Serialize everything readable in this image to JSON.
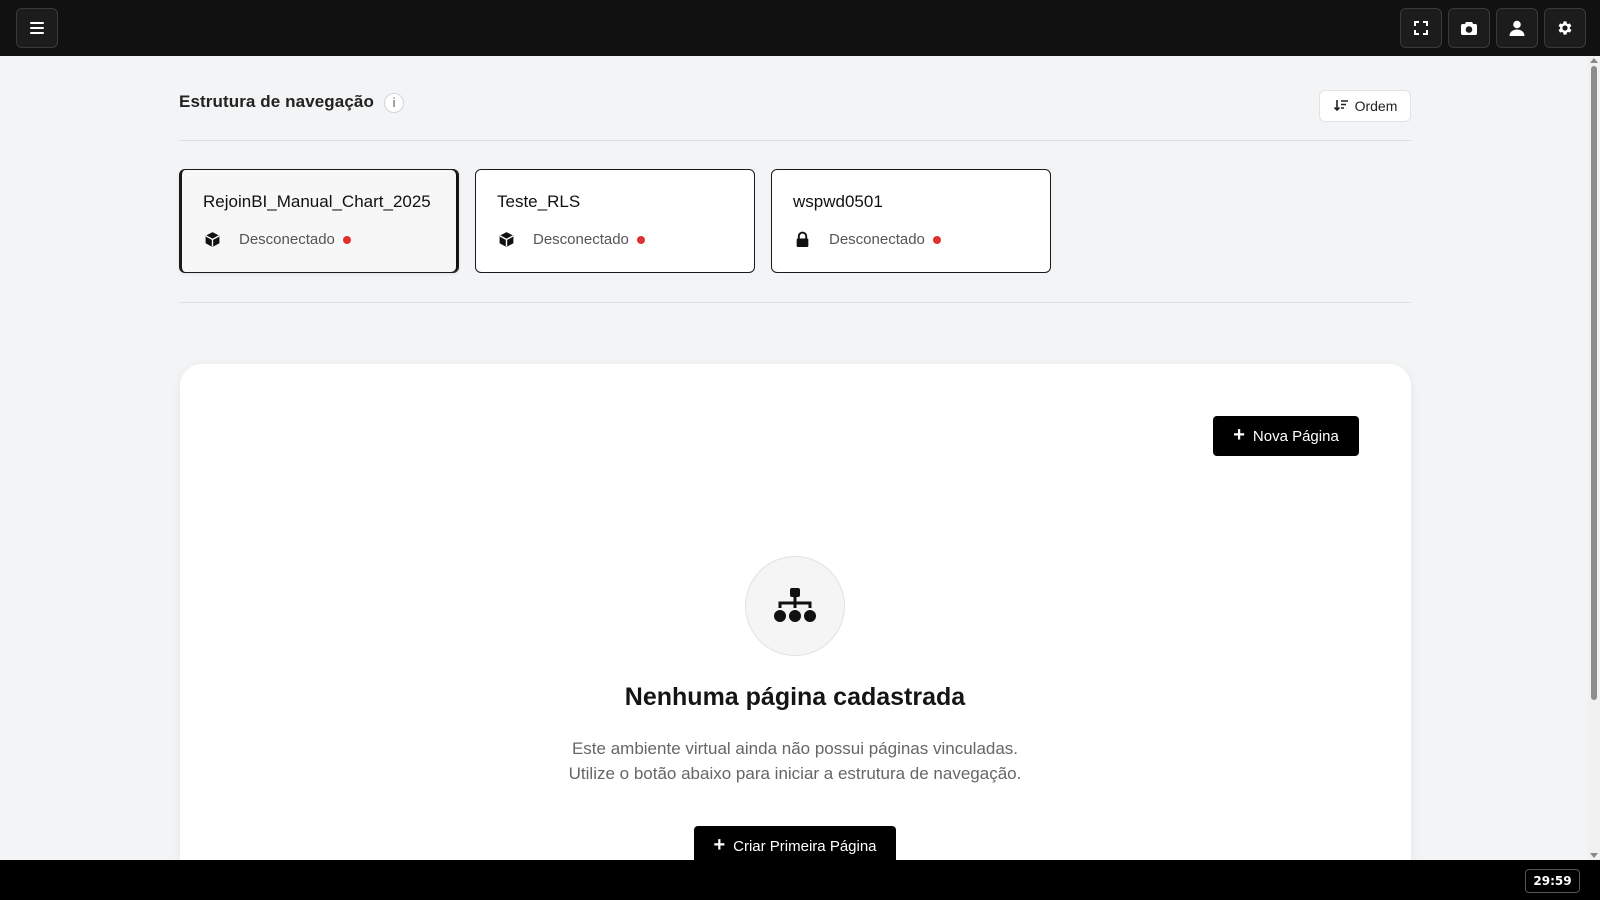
{
  "topbar": {
    "menu_icon": "hamburger-menu-icon",
    "right_icons": [
      "fullscreen-icon",
      "camera-icon",
      "user-icon",
      "gear-icon"
    ]
  },
  "header": {
    "title": "Estrutura de navegação",
    "info_icon_text": "i",
    "order_button_label": "Ordem"
  },
  "cards": [
    {
      "name": "RejoinBI_Manual_Chart_2025",
      "status": "Desconectado",
      "icon": "cube-icon",
      "selected": true
    },
    {
      "name": "Teste_RLS",
      "status": "Desconectado",
      "icon": "cube-icon",
      "selected": false
    },
    {
      "name": "wspwd0501",
      "status": "Desconectado",
      "icon": "lock-icon",
      "selected": false
    }
  ],
  "panel": {
    "new_page_label": "Nova Página",
    "empty_icon": "sitemap-icon",
    "empty_title": "Nenhuma página cadastrada",
    "empty_desc_line1": "Este ambiente virtual ainda não possui páginas vinculadas.",
    "empty_desc_line2": "Utilize o botão abaixo para iniciar a estrutura de navegação.",
    "create_first_label": "Criar Primeira Página"
  },
  "footer": {
    "timer": "29:59"
  },
  "colors": {
    "topbar_bg": "#111111",
    "status_disconnected": "#e03131",
    "primary_button": "#000000"
  }
}
